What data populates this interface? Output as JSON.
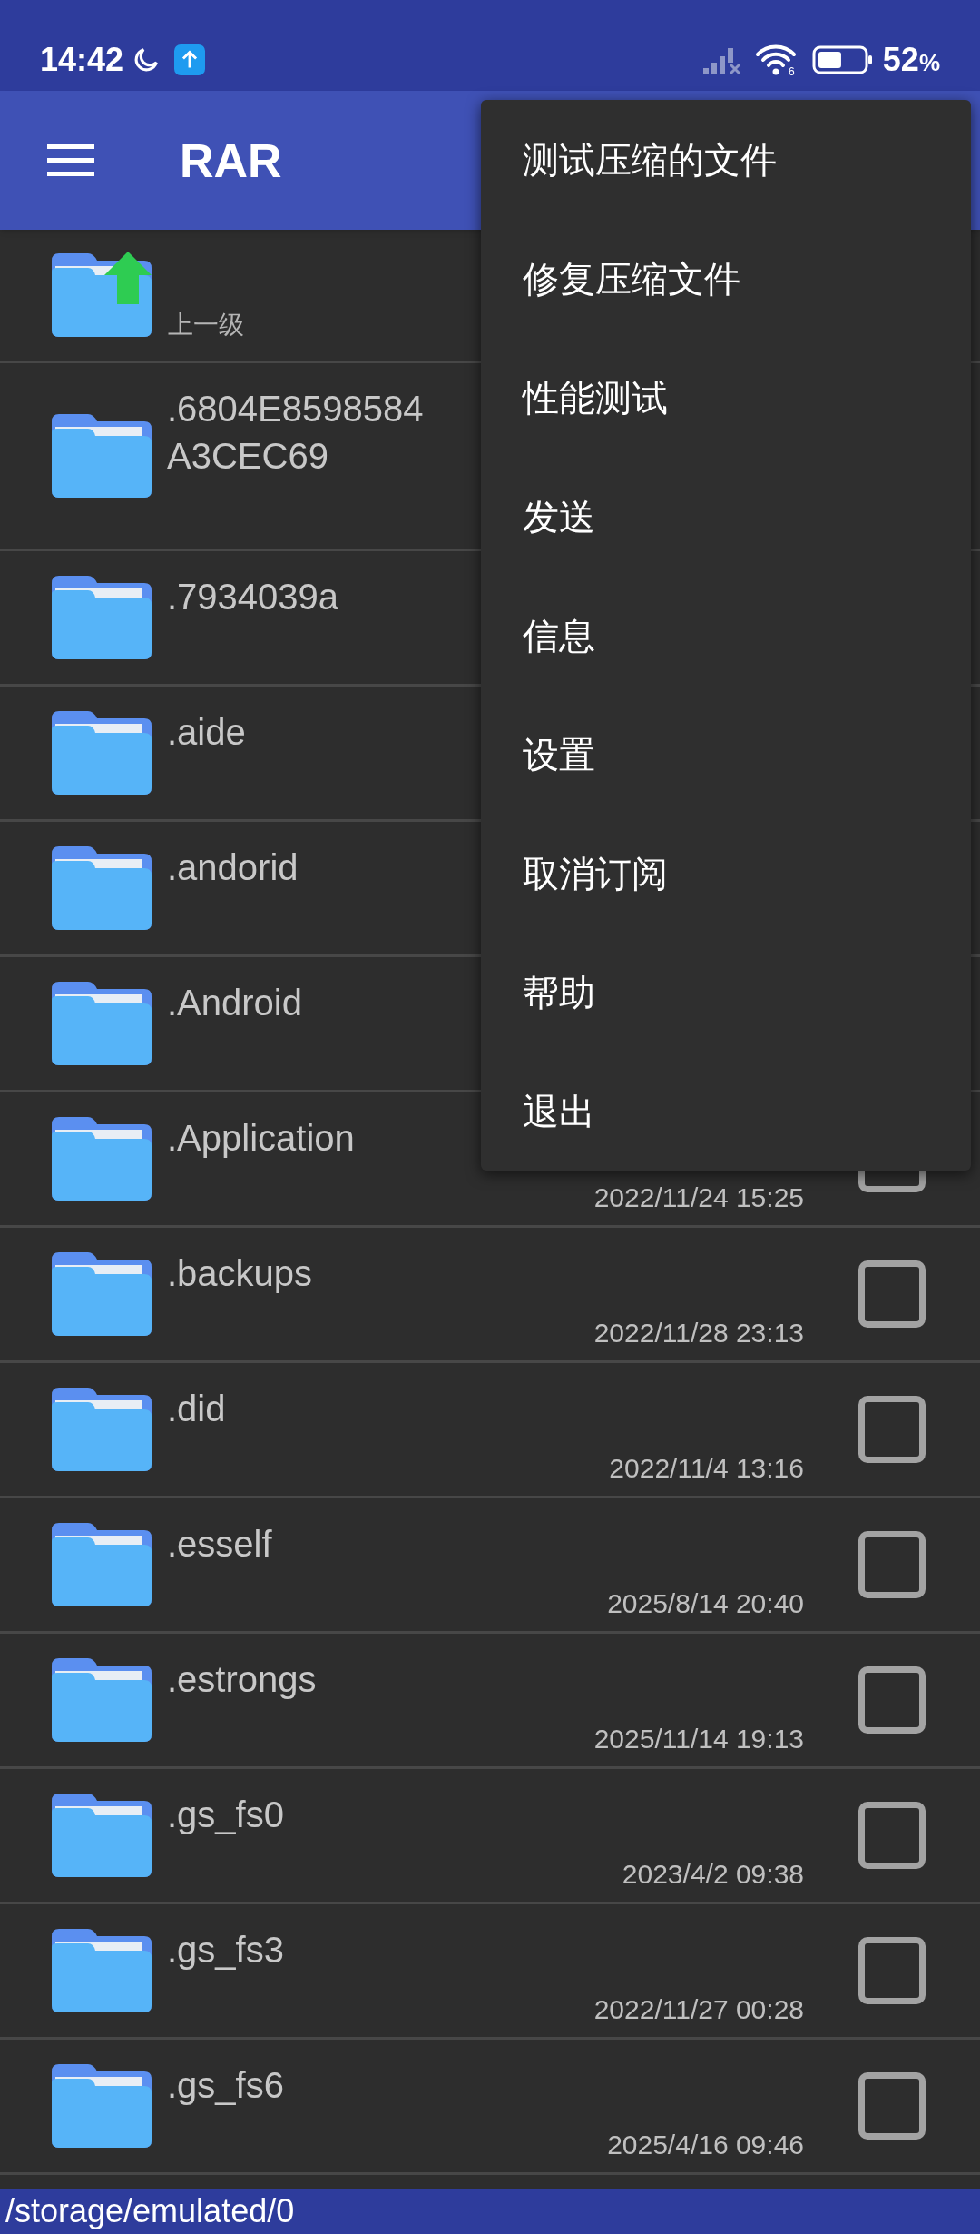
{
  "status_bar": {
    "time": "14:42",
    "battery": "52",
    "battery_unit": "%",
    "wifi_standard": "6"
  },
  "toolbar": {
    "title": "RAR"
  },
  "parent_row": {
    "label": "上一级"
  },
  "files": [
    {
      "name_lines": [
        ".6804E8598584",
        "A3CEC69"
      ]
    },
    {
      "name_lines": [
        ".7934039a"
      ]
    },
    {
      "name_lines": [
        ".aide"
      ]
    },
    {
      "name_lines": [
        ".andorid"
      ]
    },
    {
      "name_lines": [
        ".Android"
      ]
    },
    {
      "name_lines": [
        ".Application"
      ],
      "date": "2022/11/24 15:25",
      "checked": false
    },
    {
      "name_lines": [
        ".backups"
      ],
      "date": "2022/11/28 23:13",
      "checked": false
    },
    {
      "name_lines": [
        ".did"
      ],
      "date": "2022/11/4 13:16",
      "checked": false
    },
    {
      "name_lines": [
        ".esself"
      ],
      "date": "2025/8/14 20:40",
      "checked": false
    },
    {
      "name_lines": [
        ".estrongs"
      ],
      "date": "2025/11/14 19:13",
      "checked": false
    },
    {
      "name_lines": [
        ".gs_fs0"
      ],
      "date": "2023/4/2 09:38",
      "checked": false
    },
    {
      "name_lines": [
        ".gs_fs3"
      ],
      "date": "2022/11/27 00:28",
      "checked": false
    },
    {
      "name_lines": [
        ".gs_fs6"
      ],
      "date": "2025/4/16 09:46",
      "checked": false
    }
  ],
  "menu": [
    "测试压缩的文件",
    "修复压缩文件",
    "性能测试",
    "发送",
    "信息",
    "设置",
    "取消订阅",
    "帮助",
    "退出"
  ],
  "path_bar": {
    "path": "/storage/emulated/0"
  }
}
